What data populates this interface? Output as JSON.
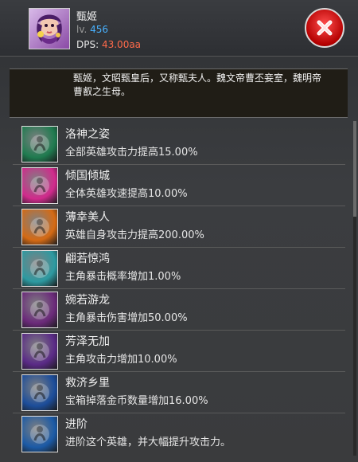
{
  "hero": {
    "name": "甄姬",
    "lv_prefix": "lv.",
    "lv_value": "456",
    "dps_prefix": "DPS:",
    "dps_value": "43.00aa",
    "description": "甄姬，文昭甄皇后，又称甄夫人。魏文帝曹丕妾室，魏明帝曹叡之生母。"
  },
  "skills": [
    {
      "title": "洛神之姿",
      "effect": "全部英雄攻击力提高15.00%",
      "icon": "luoshen-pose-icon",
      "color": "#1f7b4f"
    },
    {
      "title": "倾国倾城",
      "effect": "全体英雄攻速提高10.00%",
      "icon": "city-tower-icon",
      "color": "#d12a8c"
    },
    {
      "title": "薄幸美人",
      "effect": "英雄自身攻击力提高200.00%",
      "icon": "silhouette-sunset-icon",
      "color": "#d56a14"
    },
    {
      "title": "翩若惊鸿",
      "effect": "主角暴击概率增加1.00%",
      "icon": "swoop-burst-icon",
      "color": "#2d9aa1"
    },
    {
      "title": "婉若游龙",
      "effect": "主角暴击伤害增加50.00%",
      "icon": "dragon-icon",
      "color": "#6b2a7a"
    },
    {
      "title": "芳泽无加",
      "effect": "主角攻击力增加10.00%",
      "icon": "bubbles-icon",
      "color": "#5a2a86"
    },
    {
      "title": "救济乡里",
      "effect": "宝箱掉落金币数量增加16.00%",
      "icon": "wave-hands-icon",
      "color": "#1c4d9a"
    },
    {
      "title": "进阶",
      "effect": "进阶这个英雄，并大幅提升攻击力。",
      "icon": "advance-orb-icon",
      "color": "#1b5aa6"
    }
  ]
}
